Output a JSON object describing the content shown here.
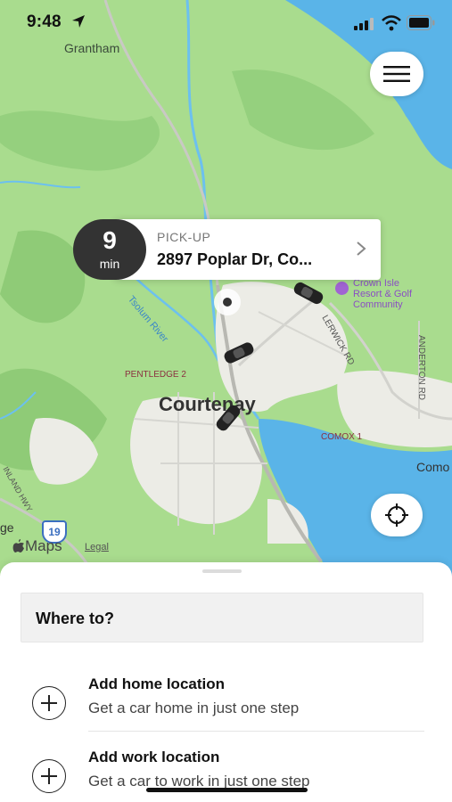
{
  "status_bar": {
    "time": "9:48"
  },
  "map": {
    "labels": {
      "grantham": "Grantham",
      "crown_isle": [
        "Crown Isle",
        "Resort & Golf",
        "Community"
      ],
      "tsolum_river": "Tsolum River",
      "lerwick_rd": "LERWICK RD",
      "anderton_rd": "ANDERTON RD",
      "pentledge": "PENTLEDGE 2",
      "courtenay": "Courtenay",
      "comox": "COMOX 1",
      "como_partial": "Como",
      "ge_partial": "ge",
      "inland_hwy": "INLAND HWY",
      "highway_shield": "19"
    }
  },
  "pickup": {
    "eta_value": "9",
    "eta_unit": "min",
    "label": "PICK-UP",
    "address": "2897 Poplar Dr, Co..."
  },
  "attribution": {
    "maps": "Maps",
    "legal": "Legal"
  },
  "sheet": {
    "where_to": "Where to?",
    "home": {
      "title": "Add home location",
      "subtitle": "Get a car home in just one step"
    },
    "work": {
      "title": "Add work location",
      "subtitle": "Get a car to work in just one step"
    }
  },
  "colors": {
    "land": "#a9dc8e",
    "forest": "#8fcf7a",
    "water": "#5ab4e8",
    "urban": "#efeee9",
    "badge": "#333333"
  }
}
